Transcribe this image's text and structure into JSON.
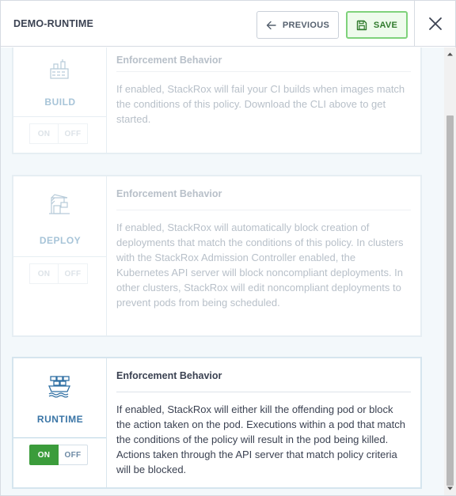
{
  "header": {
    "title": "DEMO-RUNTIME",
    "previous_label": "PREVIOUS",
    "save_label": "SAVE"
  },
  "stages": [
    {
      "name": "BUILD",
      "state": "disabled",
      "toggle": {
        "on": "ON",
        "off": "OFF",
        "selected": "off"
      },
      "heading": "Enforcement Behavior",
      "text": "If enabled, StackRox will fail your CI builds when images match the conditions of this policy. Download the CLI above to get started."
    },
    {
      "name": "DEPLOY",
      "state": "disabled",
      "toggle": {
        "on": "ON",
        "off": "OFF",
        "selected": "off"
      },
      "heading": "Enforcement Behavior",
      "text": "If enabled, StackRox will automatically block creation of deployments that match the conditions of this policy. In clusters with the StackRox Admission Controller enabled, the Kubernetes API server will block noncompliant deployments. In other clusters, StackRox will edit noncompliant deployments to prevent pods from being scheduled."
    },
    {
      "name": "RUNTIME",
      "state": "enabled",
      "toggle": {
        "on": "ON",
        "off": "OFF",
        "selected": "on"
      },
      "heading": "Enforcement Behavior",
      "text": "If enabled, StackRox will either kill the offending pod or block the action taken on the pod. Executions within a pod that match the conditions of the policy will result in the pod being killed. Actions taken through the API server that match policy criteria will be blocked."
    }
  ],
  "colors": {
    "accent_green": "#3b9c3b",
    "save_border": "#7fd27b",
    "muted_text": "#b8c0c9",
    "active_label": "#3a75a6"
  },
  "icons": [
    "arrow-left-icon",
    "save-disk-icon",
    "close-icon",
    "build-factory-icon",
    "deploy-crane-icon",
    "runtime-ship-icon"
  ]
}
